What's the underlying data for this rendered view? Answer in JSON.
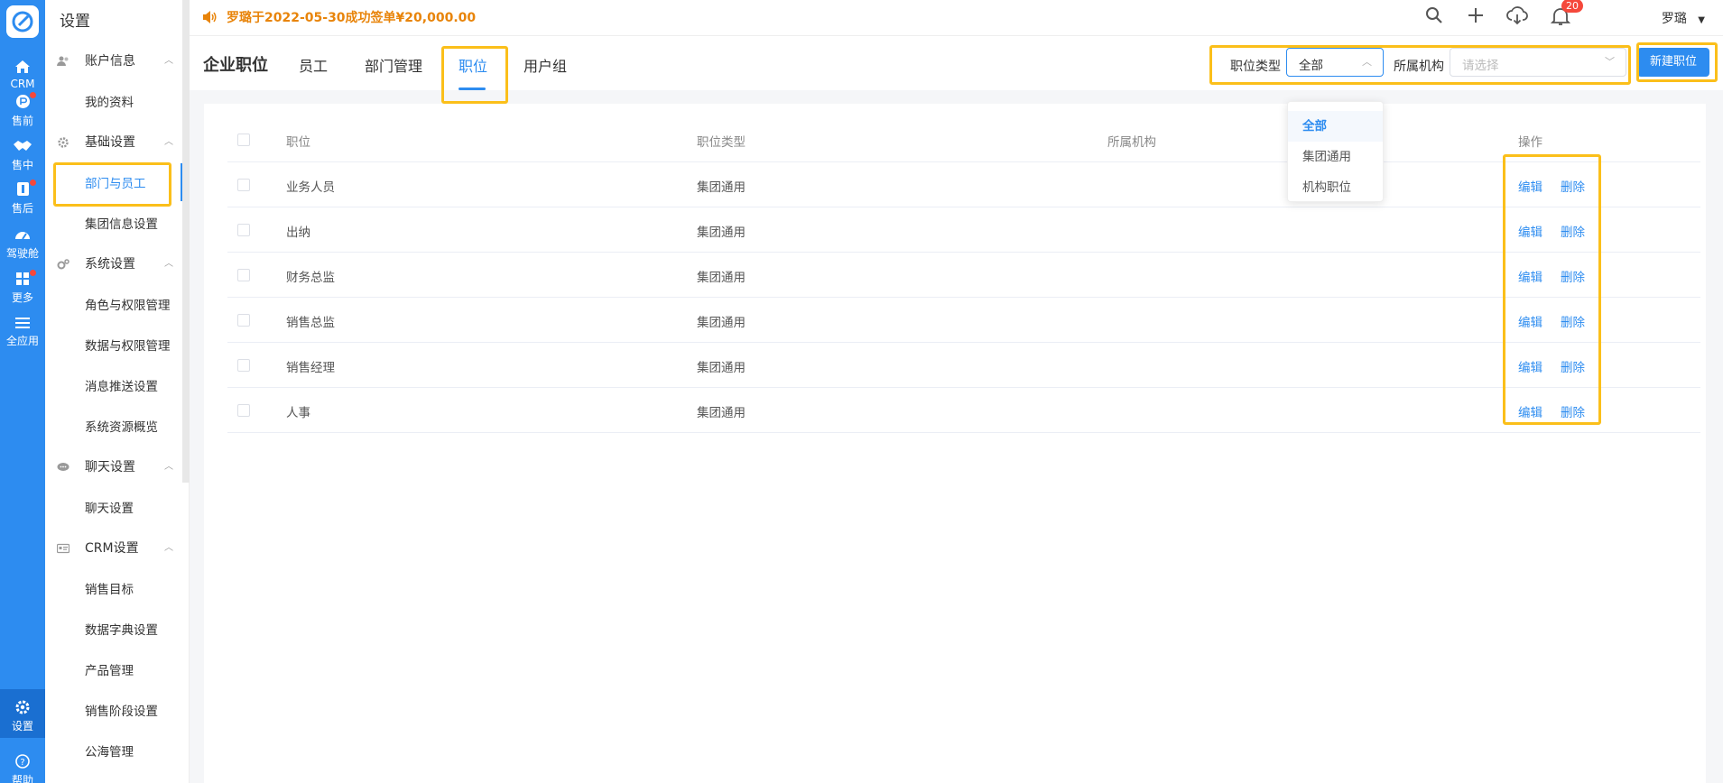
{
  "rail": {
    "items": [
      {
        "label": "CRM"
      },
      {
        "label": "售前"
      },
      {
        "label": "售中"
      },
      {
        "label": "售后"
      },
      {
        "label": "驾驶舱"
      },
      {
        "label": "更多"
      },
      {
        "label": "全应用"
      },
      {
        "label": "设置"
      },
      {
        "label": "帮助"
      }
    ]
  },
  "sidebar": {
    "title": "设置",
    "groups": [
      {
        "label": "账户信息",
        "items": [
          "我的资料"
        ]
      },
      {
        "label": "基础设置",
        "items": [
          "部门与员工",
          "集团信息设置"
        ]
      },
      {
        "label": "系统设置",
        "items": [
          "角色与权限管理",
          "数据与权限管理",
          "消息推送设置",
          "系统资源概览"
        ]
      },
      {
        "label": "聊天设置",
        "items": [
          "聊天设置"
        ]
      },
      {
        "label": "CRM设置",
        "items": [
          "销售目标",
          "数据字典设置",
          "产品管理",
          "销售阶段设置",
          "公海管理"
        ]
      }
    ],
    "active_item": "部门与员工"
  },
  "topbar": {
    "notice": "罗璐于2022-05-30成功签单¥20,000.00",
    "notification_count": "20",
    "user_name": "罗璐"
  },
  "header": {
    "page_title": "企业职位",
    "tabs": [
      "员工",
      "部门管理",
      "职位",
      "用户组"
    ],
    "active_tab": "职位",
    "filter_type_label": "职位类型",
    "filter_type_value": "全部",
    "filter_org_label": "所属机构",
    "filter_org_placeholder": "请选择",
    "new_button": "新建职位"
  },
  "dropdown": {
    "options": [
      "全部",
      "集团通用",
      "机构职位"
    ],
    "selected": "全部"
  },
  "table": {
    "columns": [
      "职位",
      "职位类型",
      "所属机构",
      "操作"
    ],
    "rows": [
      {
        "position": "业务人员",
        "type": "集团通用",
        "org": "",
        "edit": "编辑",
        "delete": "删除"
      },
      {
        "position": "出纳",
        "type": "集团通用",
        "org": "",
        "edit": "编辑",
        "delete": "删除"
      },
      {
        "position": "财务总监",
        "type": "集团通用",
        "org": "",
        "edit": "编辑",
        "delete": "删除"
      },
      {
        "position": "销售总监",
        "type": "集团通用",
        "org": "",
        "edit": "编辑",
        "delete": "删除"
      },
      {
        "position": "销售经理",
        "type": "集团通用",
        "org": "",
        "edit": "编辑",
        "delete": "删除"
      },
      {
        "position": "人事",
        "type": "集团通用",
        "org": "",
        "edit": "编辑",
        "delete": "删除"
      }
    ]
  },
  "colors": {
    "accent": "#2d8cf0",
    "highlight": "#fbbf1a",
    "notice": "#e8840a"
  }
}
